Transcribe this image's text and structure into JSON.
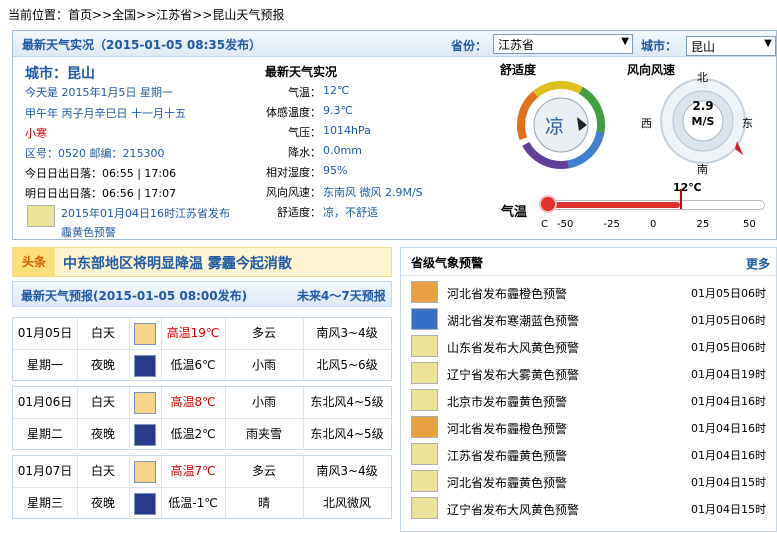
{
  "breadcrumb": {
    "prefix": "当前位置：",
    "home": "首页",
    "sep1": ">>",
    "country": "全国",
    "sep2": ">>",
    "province": "江苏省",
    "sep3": ">>",
    "page": "昆山天气预报"
  },
  "live": {
    "title": "最新天气实况（2015-01-05 08:35发布）",
    "province_label": "省份：",
    "province_value": "江苏省",
    "city_label": "城市：",
    "city_value": "昆山",
    "city_title": "城市：昆山",
    "date_line": "今天是 2015年1月5日 星期一",
    "lunar_line": "甲午年 丙子月辛巳日 十一月十五",
    "solar_term": "小寒",
    "codes": "区号：0520  邮编：215300",
    "today_sun": "今日日出日落：06:55 | 17:06",
    "tomorrow_sun": "明日日出日落：06:56 | 17:07",
    "warning_text": "2015年01月04日16时江苏省发布霾黄色预警",
    "obs_title": "最新天气实况",
    "obs": [
      {
        "label": "气温：",
        "value": "12℃"
      },
      {
        "label": "体感温度：",
        "value": "9.3℃"
      },
      {
        "label": "气压：",
        "value": "1014hPa"
      },
      {
        "label": "降水：",
        "value": "0.0mm"
      },
      {
        "label": "相对湿度：",
        "value": "95%"
      },
      {
        "label": "风向风速：",
        "value": "东南风 微风 2.9M/S"
      },
      {
        "label": "舒适度：",
        "value": "凉，不舒适"
      }
    ],
    "comfort_title": "舒适度",
    "comfort_value": "凉",
    "wind_title": "风向风速",
    "wind_speed": "2.9",
    "wind_unit": "M/S",
    "compass": {
      "n": "北",
      "s": "南",
      "e": "东",
      "w": "西"
    },
    "temp_label": "气温",
    "temp_value": "12℃",
    "temp_current": 12,
    "temp_scale": {
      "unit": "C",
      "ticks": [
        "-50",
        "-25",
        "0",
        "25",
        "50"
      ],
      "min": -50,
      "max": 50
    }
  },
  "news": {
    "tag": "头条",
    "headline": "中东部地区将明显降温 雾霾今起消散"
  },
  "forecast": {
    "title": "最新天气预报(2015-01-05 08:00发布)",
    "link": "未来4～7天预报",
    "days": [
      {
        "date": "01月05日",
        "week": "星期一",
        "day": {
          "period": "白天",
          "icon": "partly-cloudy-icon",
          "temp": "高温19℃",
          "weather": "多云",
          "wind": "南风3~4级"
        },
        "night": {
          "period": "夜晚",
          "icon": "rain-night-icon",
          "temp": "低温6℃",
          "weather": "小雨",
          "wind": "北风5~6级"
        }
      },
      {
        "date": "01月06日",
        "week": "星期二",
        "day": {
          "period": "白天",
          "icon": "rain-day-icon",
          "temp": "高温8℃",
          "weather": "小雨",
          "wind": "东北风4~5级"
        },
        "night": {
          "period": "夜晚",
          "icon": "sleet-night-icon",
          "temp": "低温2℃",
          "weather": "雨夹雪",
          "wind": "东北风4~5级"
        }
      },
      {
        "date": "01月07日",
        "week": "星期三",
        "day": {
          "period": "白天",
          "icon": "partly-cloudy-icon",
          "temp": "高温7℃",
          "weather": "多云",
          "wind": "南风3~4级"
        },
        "night": {
          "period": "夜晚",
          "icon": "moon-icon",
          "temp": "低温-1℃",
          "weather": "晴",
          "wind": "北风微风"
        }
      }
    ]
  },
  "alerts": {
    "title": "省级气象预警",
    "more": "更多",
    "items": [
      {
        "text": "河北省发布霾橙色预警",
        "date": "01月05日06时",
        "color": "#e8a040"
      },
      {
        "text": "湖北省发布寒潮蓝色预警",
        "date": "01月05日06时",
        "color": "#3a6fc8"
      },
      {
        "text": "山东省发布大风黄色预警",
        "date": "01月05日06时",
        "color": "#ece39a"
      },
      {
        "text": "辽宁省发布大雾黄色预警",
        "date": "01月04日19时",
        "color": "#ece39a"
      },
      {
        "text": "北京市发布霾黄色预警",
        "date": "01月04日16时",
        "color": "#ece39a"
      },
      {
        "text": "河北省发布霾橙色预警",
        "date": "01月04日16时",
        "color": "#e8a040"
      },
      {
        "text": "江苏省发布霾黄色预警",
        "date": "01月04日16时",
        "color": "#ece39a"
      },
      {
        "text": "河北省发布霾黄色预警",
        "date": "01月04日15时",
        "color": "#ece39a"
      },
      {
        "text": "辽宁省发布大风黄色预警",
        "date": "01月04日15时",
        "color": "#ece39a"
      }
    ]
  }
}
